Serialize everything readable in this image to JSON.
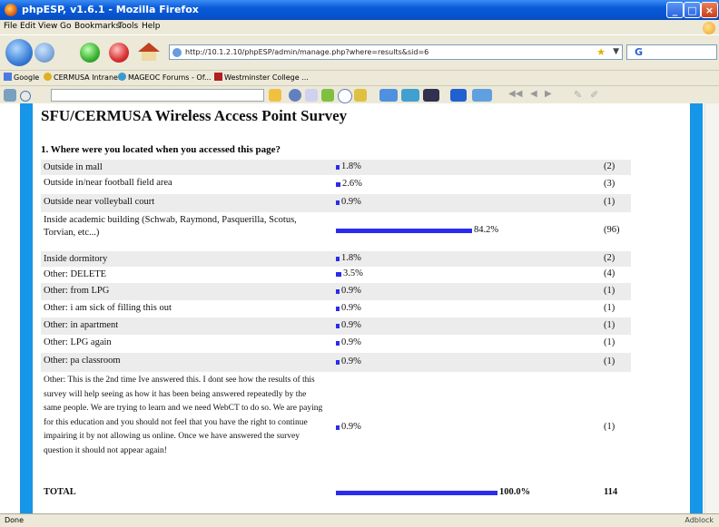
{
  "window": {
    "title": "phpESP, v1.6.1 - Mozilla Firefox"
  },
  "menu": [
    "File",
    "Edit",
    "View",
    "Go",
    "Bookmarks",
    "Tools",
    "Help"
  ],
  "nav": {
    "url": "http://10.1.2.10/phpESP/admin/manage.php?where=results&sid=6",
    "search_engine": "G"
  },
  "bookmarks": [
    "Google",
    "CERMUSA Intranet",
    "MAGEOC Forums - Of...",
    "Westminster College ..."
  ],
  "survey": {
    "title": "SFU/CERMUSA Wireless Access Point Survey",
    "question": "1. Where were you located when you accessed this page?",
    "bar_color": "#2b2bf0",
    "rows": [
      {
        "label": "Outside in mall",
        "percent": "1.8%",
        "value": 1.8,
        "count": "(2)"
      },
      {
        "label": "Outside in/near football field area",
        "percent": "2.6%",
        "value": 2.6,
        "count": "(3)"
      },
      {
        "label": "Outside near volleyball court",
        "percent": "0.9%",
        "value": 0.9,
        "count": "(1)"
      },
      {
        "label": "Inside academic building (Schwab, Raymond, Pasquerilla, Scotus, Torvian, etc...)",
        "percent": "84.2%",
        "value": 84.2,
        "count": "(96)"
      },
      {
        "label": "Inside dormitory",
        "percent": "1.8%",
        "value": 1.8,
        "count": "(2)"
      },
      {
        "label": "Other: DELETE",
        "percent": "3.5%",
        "value": 3.5,
        "count": "(4)"
      },
      {
        "label": "Other: from LPG",
        "percent": "0.9%",
        "value": 0.9,
        "count": "(1)"
      },
      {
        "label": "Other: i am sick of filling this out",
        "percent": "0.9%",
        "value": 0.9,
        "count": "(1)"
      },
      {
        "label": "Other: in apartment",
        "percent": "0.9%",
        "value": 0.9,
        "count": "(1)"
      },
      {
        "label": "Other: LPG again",
        "percent": "0.9%",
        "value": 0.9,
        "count": "(1)"
      },
      {
        "label": "Other: pa classroom",
        "percent": "0.9%",
        "value": 0.9,
        "count": "(1)"
      },
      {
        "label": "Other: This is the 2nd time Ive answered this. I dont see how the results of this survey will help seeing as how it has been being answered repeatedly by the same people. We are trying to learn and we need WebCT to do so. We are paying for this education and you should not feel that you have the right to continue impairing it by not allowing us online. Once we have answered the survey question it should not appear again!",
        "percent": "0.9%",
        "value": 0.9,
        "count": "(1)"
      }
    ],
    "total": {
      "label": "TOTAL",
      "percent": "100.0%",
      "value": 100.0,
      "count": "114"
    }
  },
  "status": {
    "text": "Done",
    "right": "Adblock"
  }
}
